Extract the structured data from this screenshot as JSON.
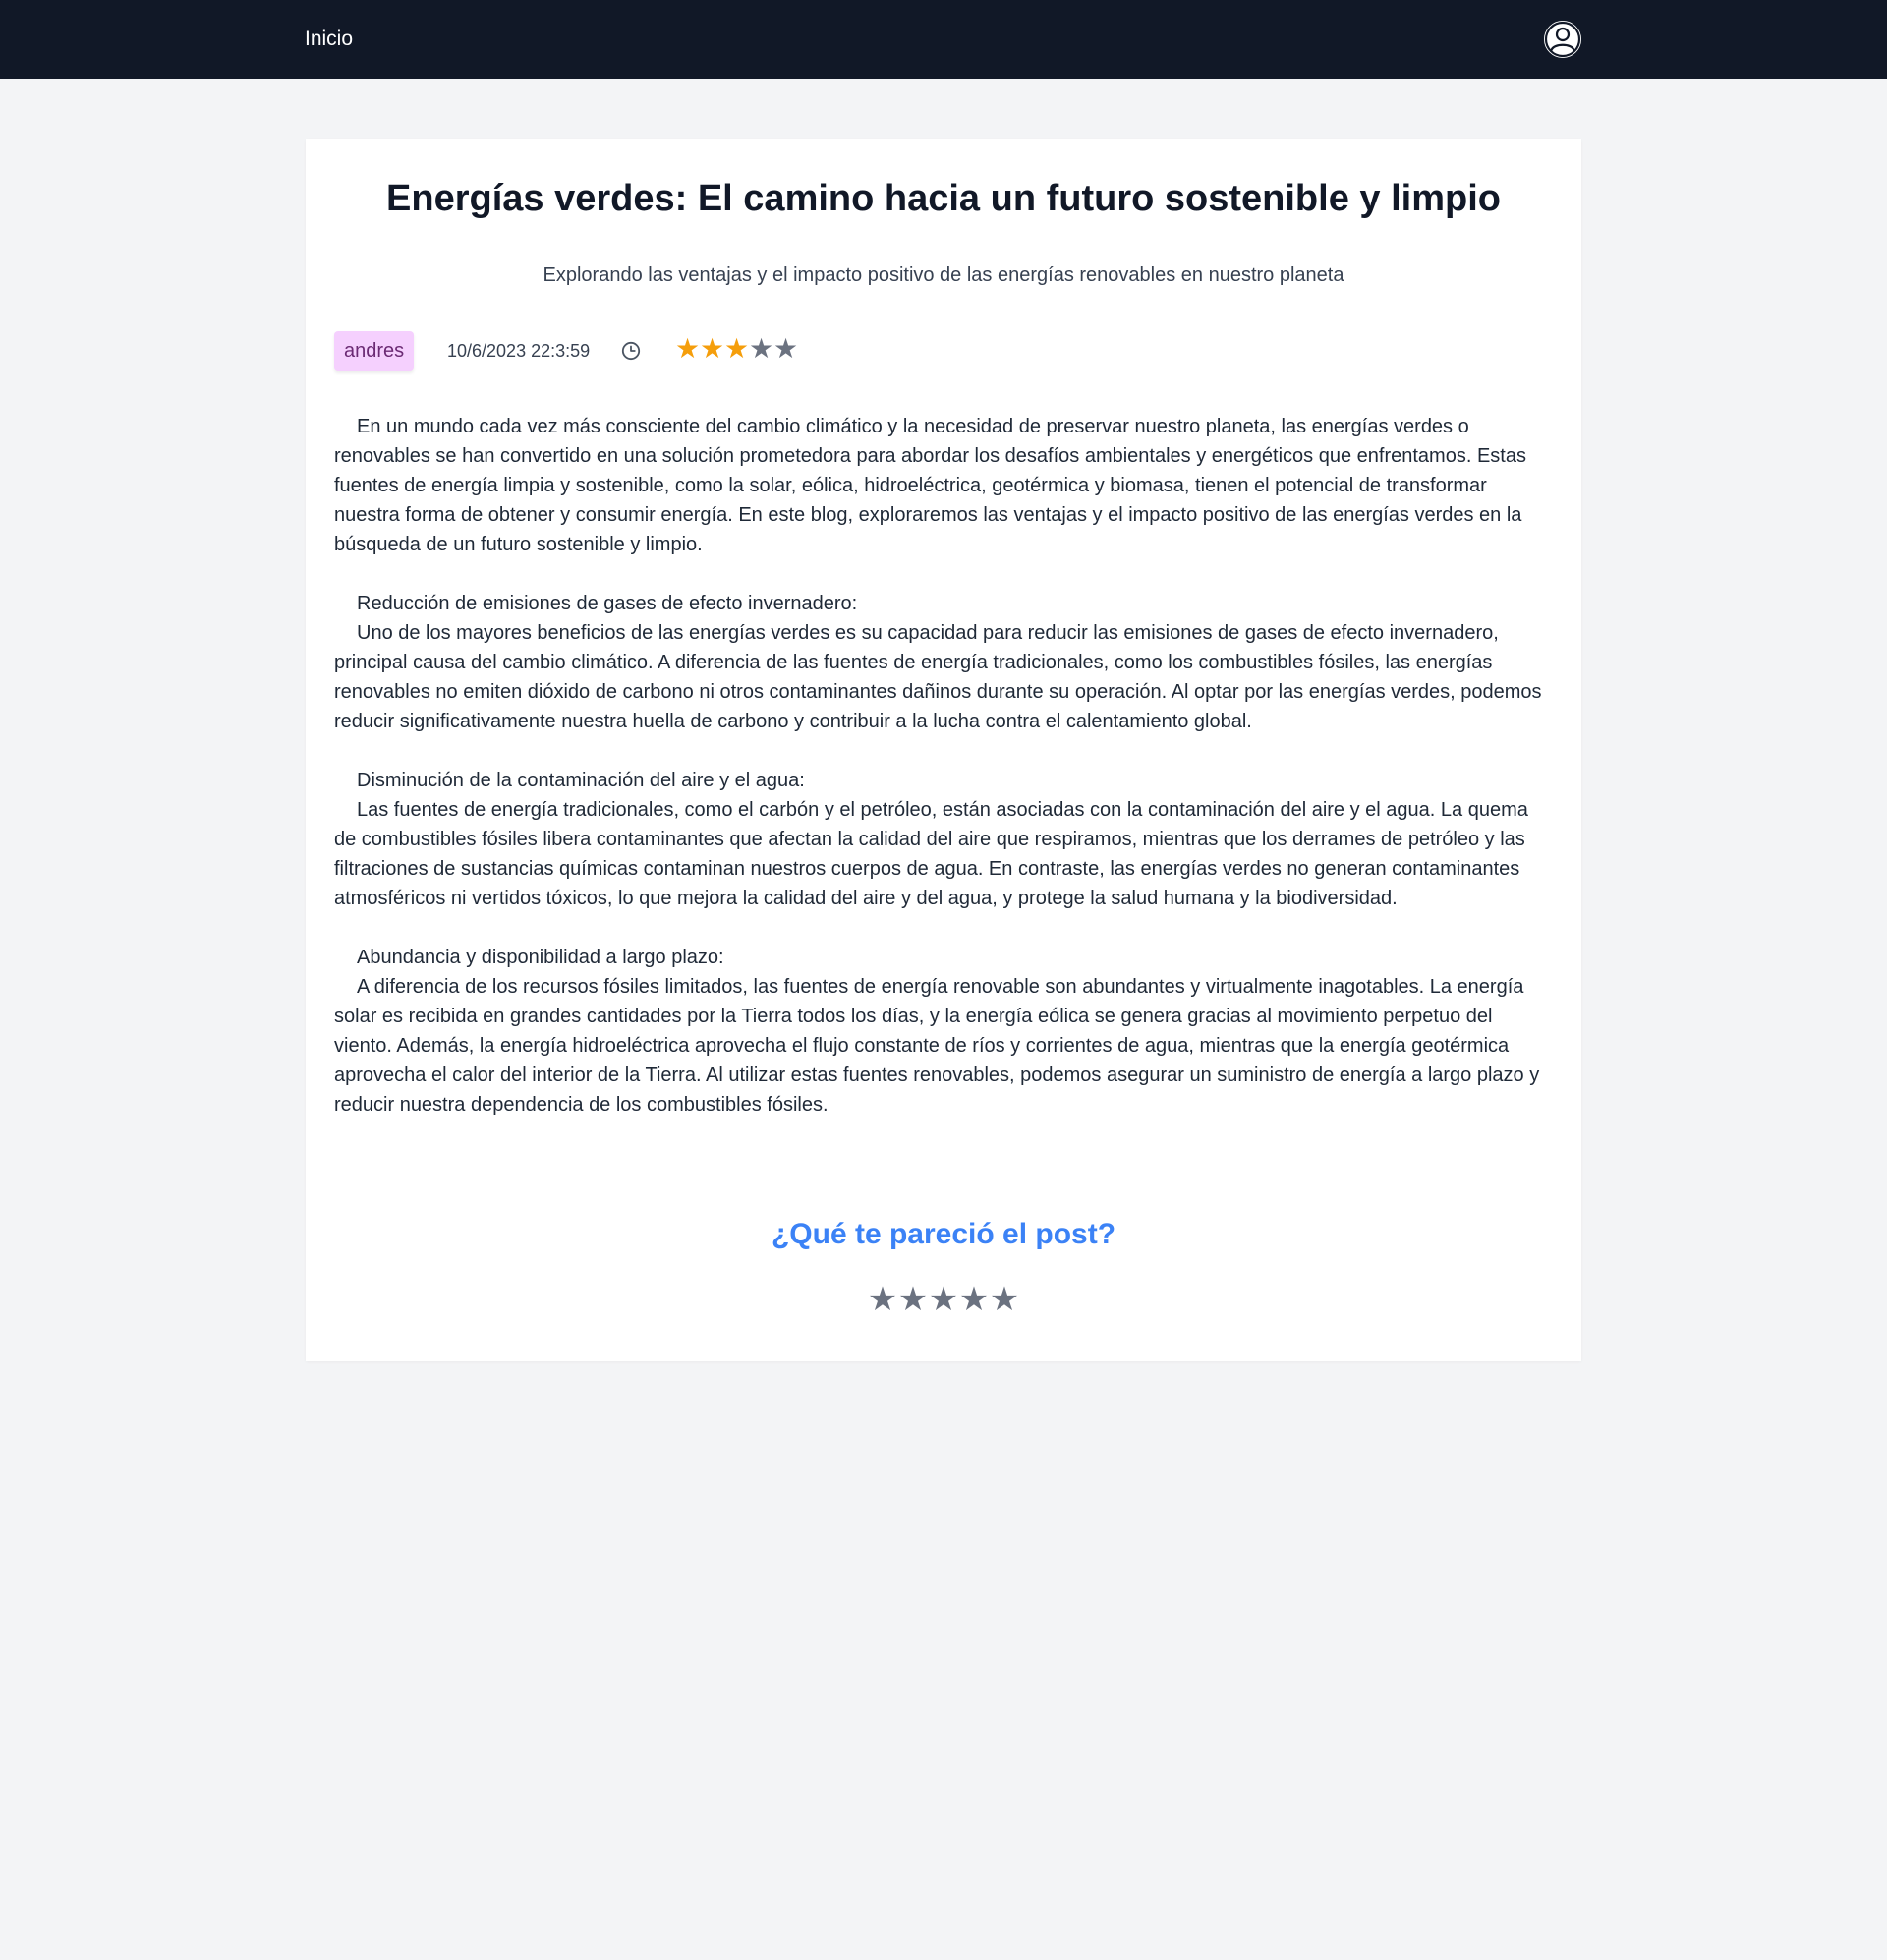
{
  "nav": {
    "home_label": "Inicio",
    "user_icon": "user-circle-icon"
  },
  "post": {
    "title": "Energías verdes: El camino hacia un futuro sostenible y limpio",
    "subtitle": "Explorando las ventajas y el impacto positivo de las energías renovables en nuestro planeta",
    "author": "andres",
    "date": "10/6/2023 22:3:59",
    "date_icon": "clock-icon",
    "rating": {
      "value": 3,
      "max": 5,
      "filled_color": "#f59e0b",
      "empty_color": "#6b7280",
      "star_glyph": "★"
    },
    "paragraphs": [
      "En un mundo cada vez más consciente del cambio climático y la necesidad de preservar nuestro planeta, las energías verdes o renovables se han convertido en una solución prometedora para abordar los desafíos ambientales y energéticos que enfrentamos. Estas fuentes de energía limpia y sostenible, como la solar, eólica, hidroeléctrica, geotérmica y biomasa, tienen el potencial de transformar nuestra forma de obtener y consumir energía. En este blog, exploraremos las ventajas y el impacto positivo de las energías verdes en la búsqueda de un futuro sostenible y limpio.",
      "Reducción de emisiones de gases de efecto invernadero:",
      "Uno de los mayores beneficios de las energías verdes es su capacidad para reducir las emisiones de gases de efecto invernadero, principal causa del cambio climático. A diferencia de las fuentes de energía tradicionales, como los combustibles fósiles, las energías renovables no emiten dióxido de carbono ni otros contaminantes dañinos durante su operación. Al optar por las energías verdes, podemos reducir significativamente nuestra huella de carbono y contribuir a la lucha contra el calentamiento global.",
      "Disminución de la contaminación del aire y el agua:",
      "Las fuentes de energía tradicionales, como el carbón y el petróleo, están asociadas con la contaminación del aire y el agua. La quema de combustibles fósiles libera contaminantes que afectan la calidad del aire que respiramos, mientras que los derrames de petróleo y las filtraciones de sustancias químicas contaminan nuestros cuerpos de agua. En contraste, las energías verdes no generan contaminantes atmosféricos ni vertidos tóxicos, lo que mejora la calidad del aire y del agua, y protege la salud humana y la biodiversidad.",
      "Abundancia y disponibilidad a largo plazo:",
      "A diferencia de los recursos fósiles limitados, las fuentes de energía renovable son abundantes y virtualmente inagotables. La energía solar es recibida en grandes cantidades por la Tierra todos los días, y la energía eólica se genera gracias al movimiento perpetuo del viento. Además, la energía hidroeléctrica aprovecha el flujo constante de ríos y corrientes de agua, mientras que la energía geotérmica aprovecha el calor del interior de la Tierra. Al utilizar estas fuentes renovables, podemos asegurar un suministro de energía a largo plazo y reducir nuestra dependencia de los combustibles fósiles."
    ]
  },
  "feedback": {
    "question": "¿Qué te pareció el post?",
    "stars": {
      "count": 5,
      "selected": 0,
      "color": "#6b7280",
      "star_glyph": "★"
    }
  },
  "colors": {
    "navbar": "#111827",
    "background": "#f3f4f6",
    "card": "#ffffff",
    "author_badge": "#f5d0fe",
    "accent": "#3b82f6"
  }
}
